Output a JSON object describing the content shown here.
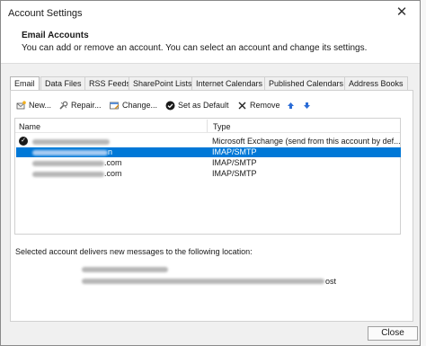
{
  "window": {
    "title": "Account Settings",
    "close_glyph": "✕"
  },
  "header": {
    "title": "Email Accounts",
    "description": "You can add or remove an account. You can select an account and change its settings."
  },
  "tabs": [
    {
      "label": "Email",
      "active": true
    },
    {
      "label": "Data Files"
    },
    {
      "label": "RSS Feeds"
    },
    {
      "label": "SharePoint Lists"
    },
    {
      "label": "Internet Calendars"
    },
    {
      "label": "Published Calendars"
    },
    {
      "label": "Address Books"
    }
  ],
  "toolbar": {
    "new_label": "New...",
    "new_icon": "new-account-icon",
    "repair_label": "Repair...",
    "repair_icon": "repair-icon",
    "change_label": "Change...",
    "change_icon": "change-icon",
    "default_label": "Set as Default",
    "default_icon": "checkmark-circle-icon",
    "remove_label": "Remove",
    "remove_icon": "remove-x-icon",
    "move_up_icon": "arrow-up-icon",
    "move_down_icon": "arrow-down-icon"
  },
  "list": {
    "col_name": "Name",
    "col_type": "Type",
    "rows": [
      {
        "name_suffix": "",
        "type": "Microsoft Exchange (send from this account by def...",
        "default": true,
        "selected": false
      },
      {
        "name_suffix": "n",
        "type": "IMAP/SMTP",
        "default": false,
        "selected": true
      },
      {
        "name_suffix": ".com",
        "type": "IMAP/SMTP",
        "default": false,
        "selected": false
      },
      {
        "name_suffix": ".com",
        "type": "IMAP/SMTP",
        "default": false,
        "selected": false
      }
    ]
  },
  "delivery": {
    "label": "Selected account delivers new messages to the following location:",
    "path_suffix": "ost"
  },
  "buttons": {
    "close_label": "Close"
  },
  "colors": {
    "selection": "#0078d7",
    "dialog_bg": "#f0f0f0",
    "arrow_blue": "#2b6cd6"
  }
}
